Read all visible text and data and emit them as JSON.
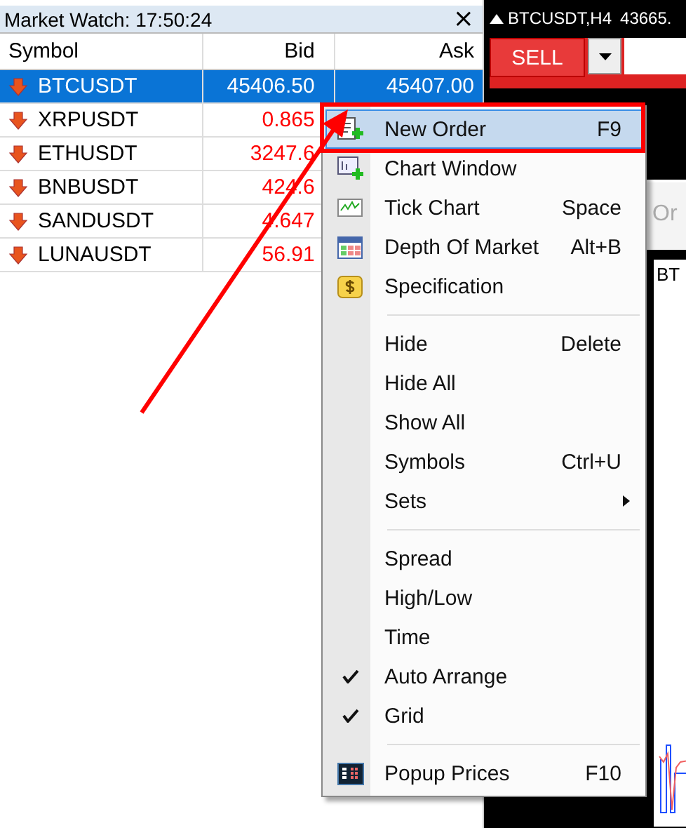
{
  "market_watch": {
    "title": "Market Watch: 17:50:24",
    "close": "×",
    "columns": [
      "Symbol",
      "Bid",
      "Ask"
    ],
    "rows": [
      {
        "symbol": "BTCUSDT",
        "bid": "45406.50",
        "ask": "45407.00",
        "selected": true
      },
      {
        "symbol": "XRPUSDT",
        "bid": "0.865",
        "selected": false
      },
      {
        "symbol": "ETHUSDT",
        "bid": "3247.6",
        "selected": false
      },
      {
        "symbol": "BNBUSDT",
        "bid": "424.6",
        "selected": false
      },
      {
        "symbol": "SANDUSDT",
        "bid": "4.647",
        "selected": false
      },
      {
        "symbol": "LUNAUSDT",
        "bid": "56.91",
        "selected": false
      }
    ]
  },
  "chart": {
    "title": "BTCUSDT,H4",
    "price": "43665.",
    "sell": "SELL",
    "tab": "Or",
    "label": "BT"
  },
  "context_menu": {
    "groups": [
      [
        {
          "label": "New Order",
          "shortcut": "F9",
          "selected": true,
          "checked": false
        },
        {
          "label": "Chart Window",
          "selected": false,
          "checked": false
        },
        {
          "label": "Tick Chart",
          "shortcut": "Space",
          "selected": false,
          "checked": false
        },
        {
          "label": "Depth Of Market",
          "shortcut": "Alt+B",
          "selected": false,
          "checked": false
        },
        {
          "label": "Specification",
          "selected": false,
          "checked": false
        }
      ],
      [
        {
          "label": "Hide",
          "shortcut": "Delete",
          "selected": false,
          "checked": false
        },
        {
          "label": "Hide All",
          "selected": false,
          "checked": false
        },
        {
          "label": "Show All",
          "selected": false,
          "checked": false
        },
        {
          "label": "Symbols",
          "shortcut": "Ctrl+U",
          "selected": false,
          "checked": false
        },
        {
          "label": "Sets",
          "submenu": true,
          "selected": false,
          "checked": false
        }
      ],
      [
        {
          "label": "Spread",
          "selected": false,
          "checked": false
        },
        {
          "label": "High/Low",
          "selected": false,
          "checked": false
        },
        {
          "label": "Time",
          "selected": false,
          "checked": false
        },
        {
          "label": "Auto Arrange",
          "selected": false,
          "checked": true
        },
        {
          "label": "Grid",
          "selected": false,
          "checked": true
        }
      ],
      [
        {
          "label": "Popup Prices",
          "shortcut": "F10",
          "selected": false,
          "checked": false
        }
      ]
    ]
  }
}
